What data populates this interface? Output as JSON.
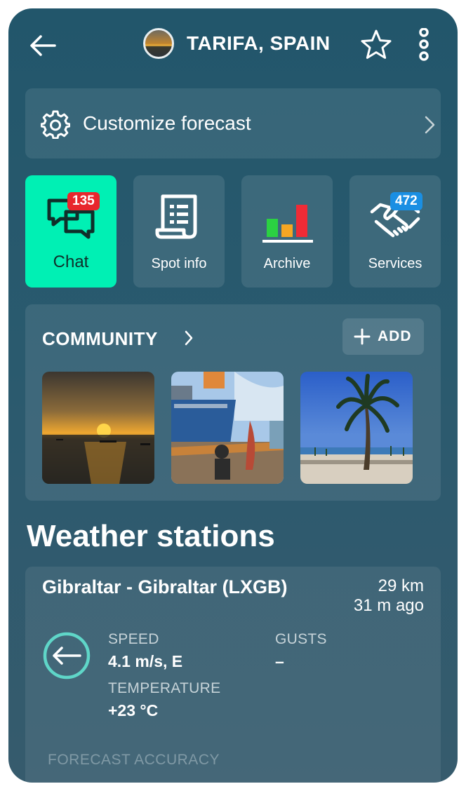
{
  "header": {
    "title": "TARIFA, SPAIN",
    "icons": {
      "back": "arrow-left-icon",
      "favorite": "star-icon",
      "more": "more-vertical-icon"
    }
  },
  "customize": {
    "label": "Customize forecast",
    "icon": "gear-icon"
  },
  "tiles": [
    {
      "label": "Chat",
      "badge": "135",
      "icon": "chat-bubbles-icon",
      "active": true
    },
    {
      "label": "Spot info",
      "icon": "document-icon"
    },
    {
      "label": "Archive",
      "icon": "bar-chart-icon"
    },
    {
      "label": "Services",
      "badge": "472",
      "icon": "handshake-icon"
    }
  ],
  "community": {
    "title": "COMMUNITY",
    "add_label": "ADD",
    "photos": [
      "sunset-photo",
      "ship-photo",
      "palm-beach-photo"
    ]
  },
  "weather": {
    "section_title": "Weather stations",
    "station": {
      "name": "Gibraltar - Gibraltar (LXGB)",
      "distance": "29 km",
      "ago": "31 m ago",
      "speed_label": "SPEED",
      "speed_value": "4.1 m/s, E",
      "gusts_label": "GUSTS",
      "gusts_value": "–",
      "temp_label": "TEMPERATURE",
      "temp_value": "+23 °C",
      "accuracy_label": "FORECAST ACCURACY"
    }
  },
  "colors": {
    "accent": "#00f0b4",
    "badge_red": "#e8262c",
    "badge_blue": "#1a8fe3",
    "background": "#2a5a6e"
  }
}
